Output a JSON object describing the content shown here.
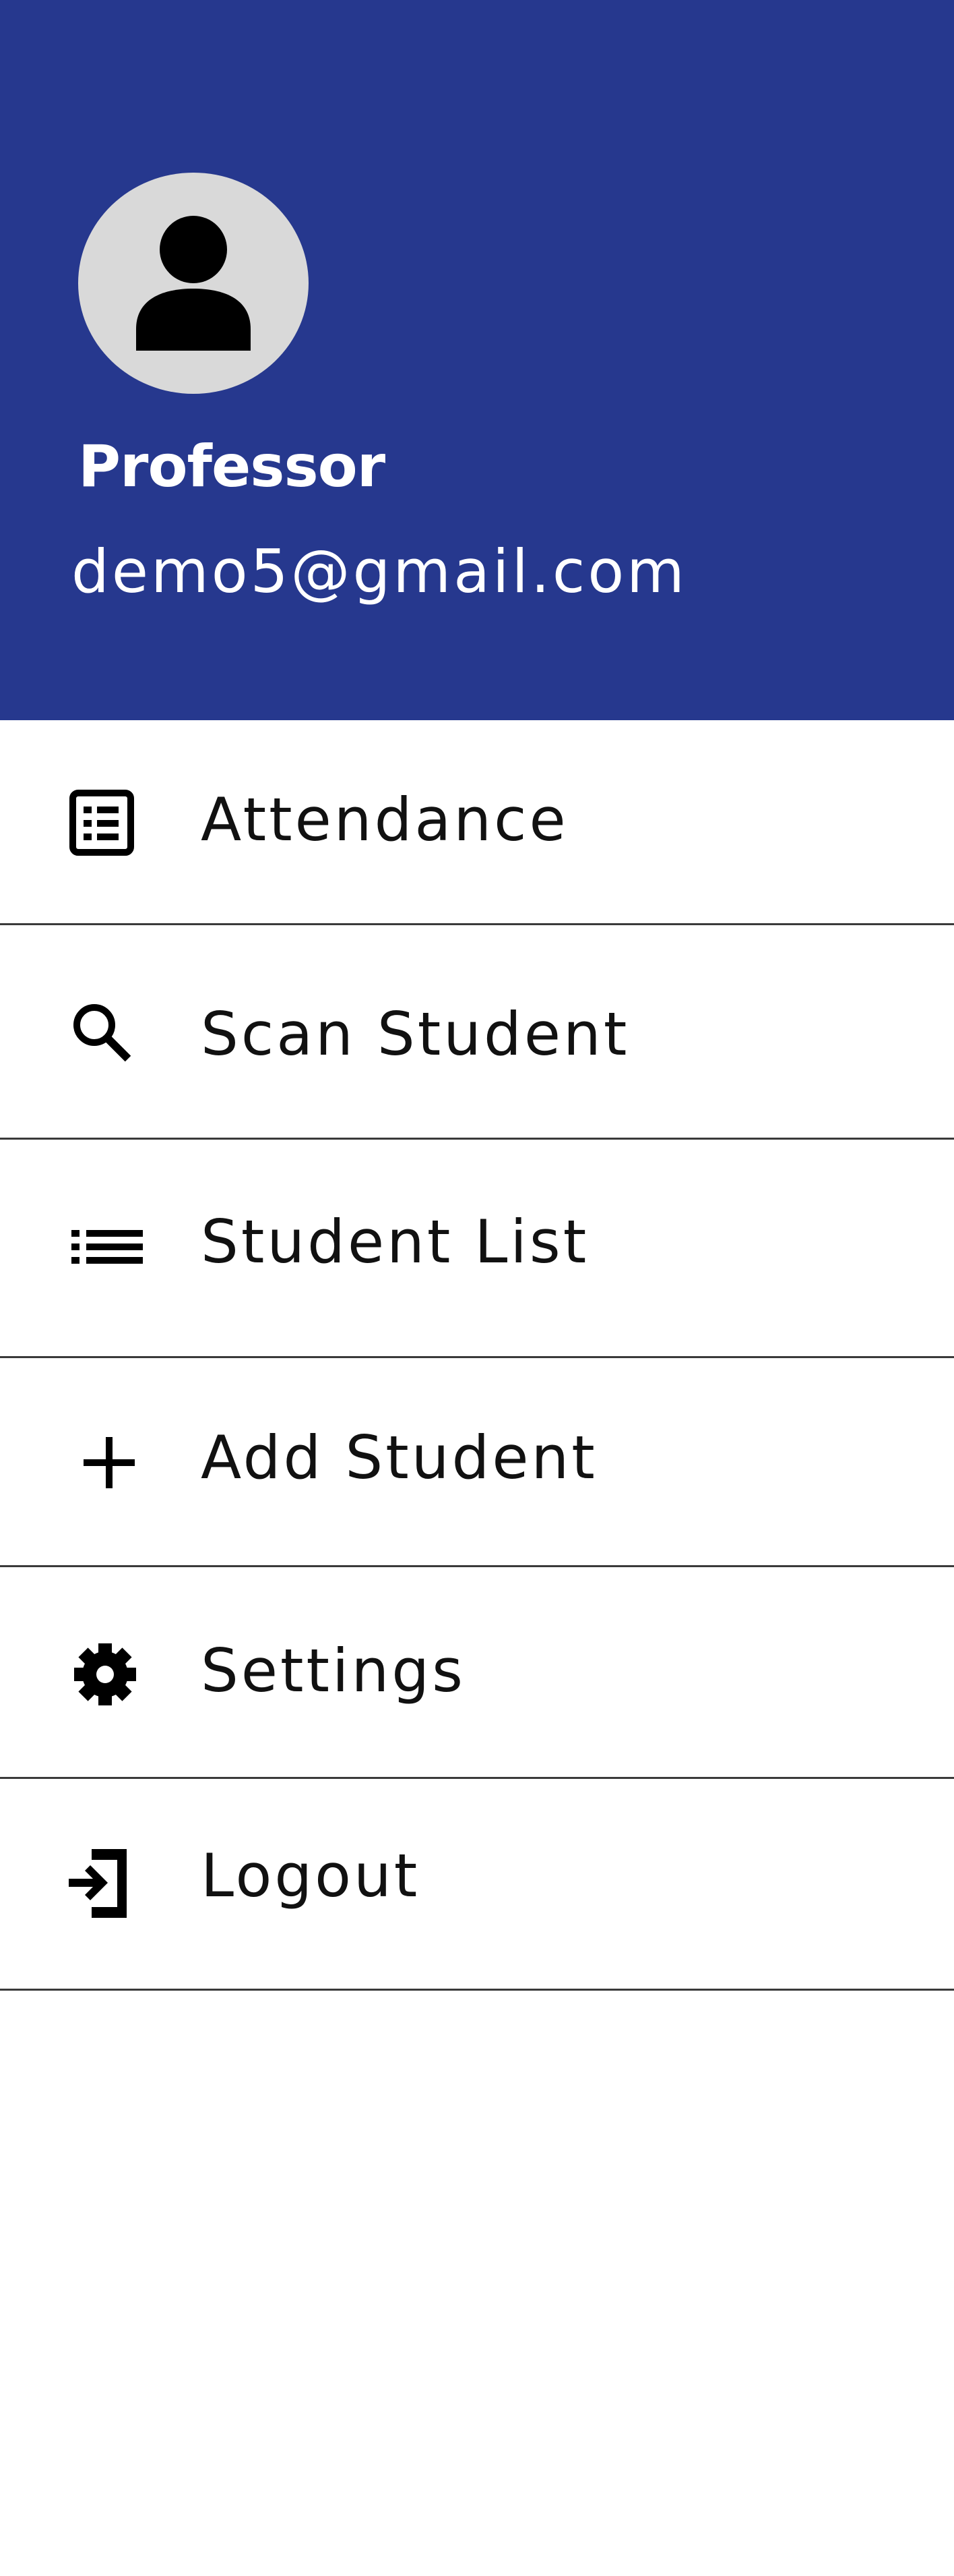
{
  "header": {
    "background_color": "#26388e",
    "avatar_icon": "person-icon",
    "name": "Professor",
    "email": "demo5@gmail.com"
  },
  "menu": {
    "items": [
      {
        "label": "Attendance",
        "icon": "list-alt-icon"
      },
      {
        "label": "Scan Student",
        "icon": "search-icon"
      },
      {
        "label": "Student List",
        "icon": "list-icon"
      },
      {
        "label": "Add Student",
        "icon": "plus-icon"
      },
      {
        "label": "Settings",
        "icon": "gear-icon"
      },
      {
        "label": "Logout",
        "icon": "login-icon"
      }
    ]
  }
}
